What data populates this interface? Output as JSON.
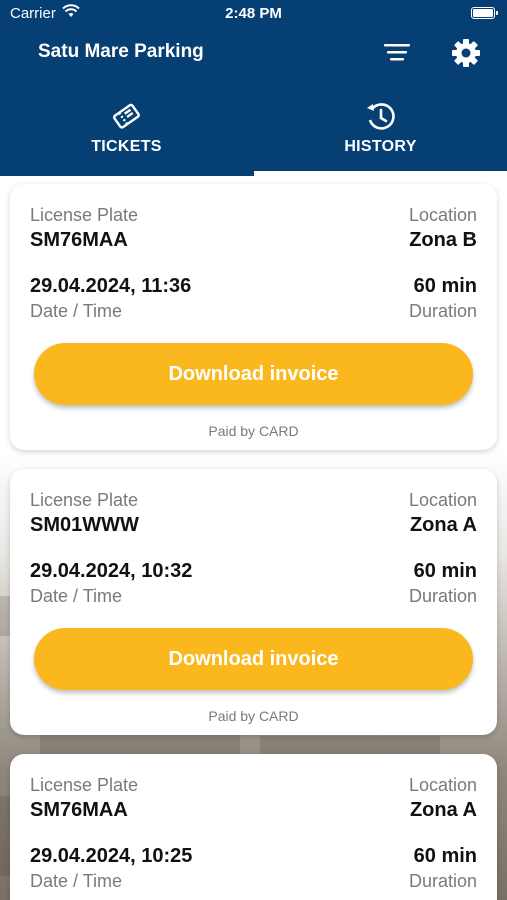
{
  "status_bar": {
    "carrier": "Carrier",
    "time": "2:48 PM"
  },
  "header": {
    "title": "Satu Mare Parking"
  },
  "tabs": [
    {
      "label": "TICKETS",
      "icon": "tickets-icon",
      "active": false
    },
    {
      "label": "HISTORY",
      "icon": "history-icon",
      "active": true
    }
  ],
  "labels": {
    "plate": "License Plate",
    "location": "Location",
    "datetime": "Date / Time",
    "duration": "Duration",
    "download": "Download invoice"
  },
  "tickets": [
    {
      "plate": "SM76MAA",
      "location": "Zona B",
      "datetime": "29.04.2024, 11:36",
      "duration": "60 min",
      "paid": "Paid by CARD"
    },
    {
      "plate": "SM01WWW",
      "location": "Zona A",
      "datetime": "29.04.2024, 10:32",
      "duration": "60 min",
      "paid": "Paid by CARD"
    },
    {
      "plate": "SM76MAA",
      "location": "Zona A",
      "datetime": "29.04.2024, 10:25",
      "duration": "60 min"
    }
  ],
  "colors": {
    "header": "#063f73",
    "accent": "#fbb81e"
  }
}
